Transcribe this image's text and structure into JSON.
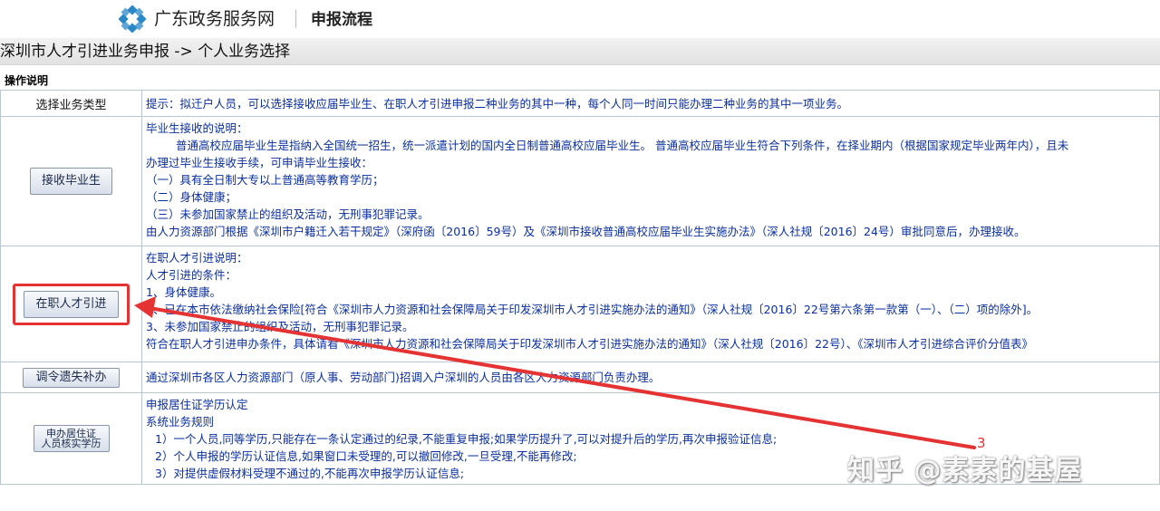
{
  "header": {
    "site_name": "广东政务服务网",
    "subtitle": "申报流程",
    "logo_color": "#2a88c9"
  },
  "breadcrumb": "深圳市人才引进业务申报 -> 个人业务选择",
  "section_title": "操作说明",
  "rows": [
    {
      "label": "选择业务类型",
      "lines": [
        "提示：拟迁户人员，可以选择接收应届毕业生、在职人才引进申报二种业务的其中一种，每个人同一时间只能办理二种业务的其中一项业务。"
      ]
    },
    {
      "button": "接收毕业生",
      "lines": [
        "毕业生接收的说明：",
        "普通高校应届毕业生是指纳入全国统一招生，统一派遣计划的国内全日制普通高校应届毕业生。 普通高校应届毕业生符合下列条件，在择业期内（根据国家规定毕业两年内），且未",
        "办理过毕业生接收手续，可申请毕业生接收：",
        "（一）具有全日制大专以上普通高等教育学历；",
        "（二）身体健康；",
        "（三）未参加国家禁止的组织及活动，无刑事犯罪记录。",
        "由人力资源部门根据《深圳市户籍迁入若干规定》（深府函〔2016〕59号）及《深圳市接收普通高校应届毕业生实施办法》（深人社规〔2016〕24号）审批同意后，办理接收。"
      ]
    },
    {
      "button": "在职人才引进",
      "lines": [
        "在职人才引进说明：",
        "人才引进的条件：",
        "1、身体健康。",
        "2、已在本市依法缴纳社会保险[符合《深圳市人力资源和社会保障局关于印发深圳市人才引进实施办法的通知》（深人社规〔2016〕22号第六条第一款第（一）、（二）项的除外]。",
        "3、未参加国家禁止的组织及活动，无刑事犯罪记录。",
        "符合在职人才引进申办条件，具体请看《深圳市人力资源和社会保障局关于印发深圳市人才引进实施办法的通知》（深人社规〔2016〕22号）、《深圳市人才引进综合评价分值表》"
      ]
    },
    {
      "button": "调令遗失补办",
      "lines": [
        "通过深圳市各区人力资源部门（原人事、劳动部门)招调入户深圳的人员由各区人力资源部门负责办理。"
      ]
    },
    {
      "button_line1": "申办居住证",
      "button_line2": "人员核实学历",
      "lines": [
        "申报居住证学历认定",
        "系统业务规则",
        "1）一个人员,同等学历,只能存在一条认定通过的纪录,不能重复申报;如果学历提升了,可以对提升后的学历,再次申报验证信息;",
        "2）个人申报的学历认证信息,如果窗口未受理的,可以撤回修改,一旦受理,不能再修改;",
        "3）对提供虚假材料受理不通过的,不能再次申报学历认证信息;"
      ]
    }
  ],
  "annotation": {
    "number": "3",
    "color": "#e53232"
  },
  "watermark": "知乎 @素素的基屋",
  "colors": {
    "desc_text": "#0b2fa0",
    "table_border": "#b9c6d6",
    "highlight": "#e53232"
  }
}
